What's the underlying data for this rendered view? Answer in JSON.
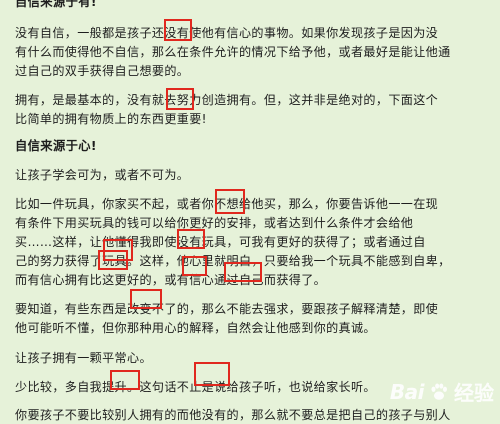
{
  "article": {
    "lines": [
      "自信来源于有!",
      "没有自信，一般都是孩子还没有使他有信心的事物。如果你发现孩子是因为没",
      "有什么而使得他不自信，那么在条件允许的情况下给予他，或者最好是能让他通",
      "过自己的双手获得自己想要的。",
      "拥有，是最基本的，没有就去努力创造拥有。但，这并非是绝对的，下面这个",
      "比简单的拥有物质上的东西更重要!",
      "自信来源于心!",
      "让孩子学会可为，或者不可为。",
      "比如一件玩具，你家买不起，或者你不想给他买，那么，你要告诉他一一在现",
      "有条件下用买玩具的钱可以给你更好的安排，或者达到什么条件才会给他",
      "买……这样，让他懂得我即使没有玩具，可我有更好的获得了；或者通过自",
      "己的努力获得了玩具。这样，他心里就明白，只要给我一个玩具不能感到自卑，",
      "而有信心拥有比这更好的，或有信心通过自己而获得了。",
      "要知道，有些东西是改变不了的，那么不能去强求，要跟孩子解释清楚，即使",
      "他可能听不懂，但你那种用心的解释，自然会让他感到你的真诚。",
      "让孩子拥有一颗平常心。",
      "少比较，多自我提升。这句话不止是说给孩子听，也说给家长听。",
      "你要孩子不要比较别人拥有的而他没有的，那么就不要总是把自己的孩子与别人"
    ]
  },
  "watermark": {
    "logo": "Bai",
    "site": "经验"
  },
  "colors": {
    "background": "#e6f2d9",
    "annotation": "#e0281e"
  }
}
